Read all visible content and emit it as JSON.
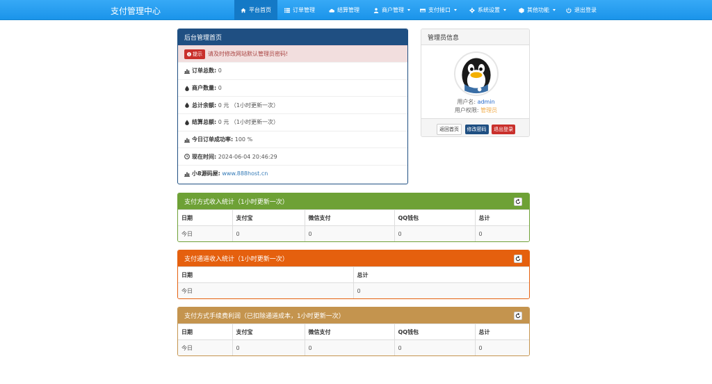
{
  "brand": "支付管理中心",
  "nav": {
    "items": [
      {
        "label": "平台首页",
        "icon": "home-icon",
        "active": true
      },
      {
        "label": "订单管理",
        "icon": "list-icon"
      },
      {
        "label": "结算管理",
        "icon": "cloud-icon"
      },
      {
        "label": "商户管理",
        "icon": "user-icon",
        "dropdown": true
      },
      {
        "label": "支付接口",
        "icon": "credit-card-icon",
        "dropdown": true
      },
      {
        "label": "系统设置",
        "icon": "gear-icon",
        "dropdown": true
      },
      {
        "label": "其他功能",
        "icon": "cube-icon",
        "dropdown": true
      },
      {
        "label": "退出登录",
        "icon": "power-icon"
      }
    ]
  },
  "dashboard": {
    "title": "后台管理首页",
    "alert_badge": "提示",
    "alert_text": "请及时修改网站默认管理员密码!",
    "rows": [
      {
        "label": "订单总数:",
        "value": "0",
        "icon": "bar-chart-icon"
      },
      {
        "label": "商户数量:",
        "value": "0",
        "icon": "drop-icon"
      },
      {
        "label": "总计余额:",
        "value": "0 元 （1小时更新一次）",
        "icon": "drop-icon"
      },
      {
        "label": "结算总额:",
        "value": "0 元 （1小时更新一次）",
        "icon": "drop-icon"
      },
      {
        "label": "今日订单成功率:",
        "value": "100 %",
        "icon": "bar-chart-icon"
      },
      {
        "label": "现在时间:",
        "value": "2024-06-04 20:46:29",
        "icon": "clock-icon"
      },
      {
        "label": "小8源码屋:",
        "value": "www.888host.cn",
        "icon": "bar-chart-icon",
        "link": true
      }
    ]
  },
  "admin": {
    "title": "管理员信息",
    "username_label": "用户名:",
    "username": "admin",
    "role_label": "用户权限:",
    "role": "管理员",
    "buttons": {
      "home": "返回首页",
      "password": "修改密码",
      "logout": "退出登录"
    }
  },
  "stats_method": {
    "title": "支付方式收入统计（1小时更新一次）",
    "color": "#6ea136",
    "headers": [
      "日期",
      "支付宝",
      "微信支付",
      "QQ钱包",
      "总计"
    ],
    "rows": [
      [
        "今日",
        "0",
        "0",
        "0",
        "0"
      ]
    ]
  },
  "stats_channel": {
    "title": "支付通道收入统计（1小时更新一次）",
    "color": "#e5600e",
    "headers": [
      "日期",
      "总计"
    ],
    "rows": [
      [
        "今日",
        "0"
      ]
    ]
  },
  "stats_fee": {
    "title": "支付方式手续费利润（已扣除通道成本，1小时更新一次）",
    "color": "#c4944e",
    "headers": [
      "日期",
      "支付宝",
      "微信支付",
      "QQ钱包",
      "总计"
    ],
    "rows": [
      [
        "今日",
        "0",
        "0",
        "0",
        "0"
      ]
    ]
  }
}
